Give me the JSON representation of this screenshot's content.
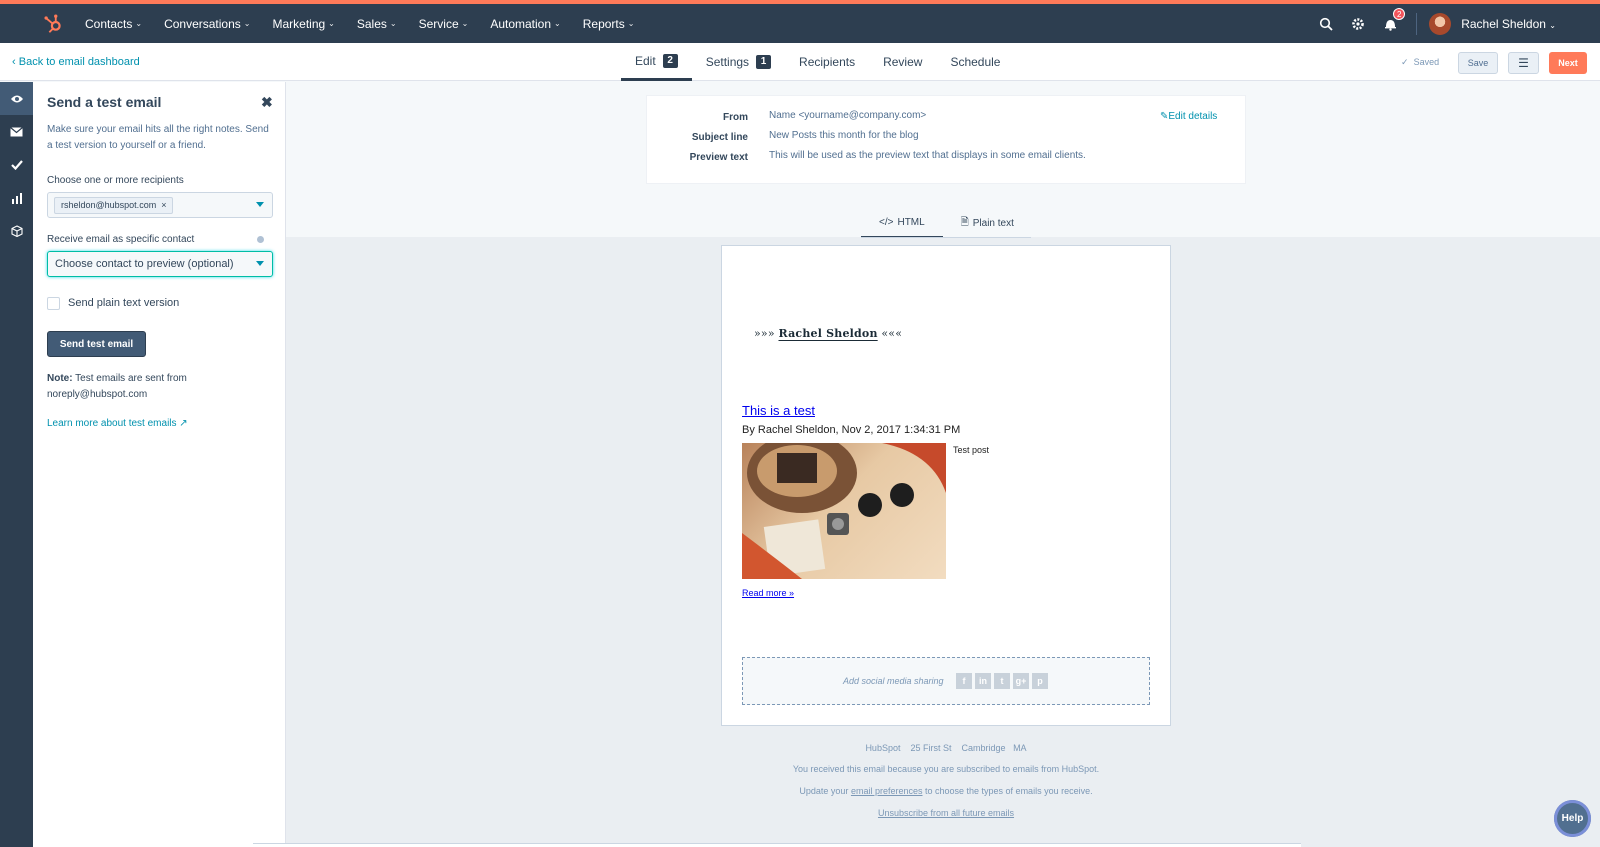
{
  "topnav": {
    "items": [
      "Contacts",
      "Conversations",
      "Marketing",
      "Sales",
      "Service",
      "Automation",
      "Reports"
    ],
    "notification_count": "2",
    "user_name": "Rachel Sheldon"
  },
  "subheader": {
    "back_link": "Back to email dashboard",
    "tabs": [
      {
        "label": "Edit",
        "badge": "2"
      },
      {
        "label": "Settings",
        "badge": "1"
      },
      {
        "label": "Recipients"
      },
      {
        "label": "Review"
      },
      {
        "label": "Schedule"
      }
    ],
    "saved_label": "Saved",
    "save_label": "Save",
    "next_label": "Next"
  },
  "rail": {
    "icons": [
      "eye-icon",
      "envelope-icon",
      "checkmark-icon",
      "analytics-icon",
      "box-icon"
    ]
  },
  "test_panel": {
    "title": "Send a test email",
    "description": "Make sure your email hits all the right notes. Send a test version to yourself or a friend.",
    "recipients_label": "Choose one or more recipients",
    "recipient_chip": "rsheldon@hubspot.com",
    "contact_label": "Receive email as specific contact",
    "contact_placeholder": "Choose contact to preview (optional)",
    "plain_text_label": "Send plain text version",
    "send_button": "Send test email",
    "note_label": "Note:",
    "note_text": "Test emails are sent from noreply@hubspot.com",
    "learn_more": "Learn more about test emails"
  },
  "details": {
    "from_label": "From",
    "from_value": "Name <yourname@company.com>",
    "subject_label": "Subject line",
    "subject_value": "New Posts this month for the blog",
    "preview_label": "Preview text",
    "preview_value": "This will be used as the preview text that displays in some email clients.",
    "edit_link": "Edit details"
  },
  "preview_tabs": {
    "html": "HTML",
    "plain": "Plain text"
  },
  "email": {
    "brand_text": "Rachel Sheldon",
    "post_title": "This is a test",
    "byline": "By Rachel Sheldon, Nov 2, 2017 1:34:31 PM",
    "post_body": "Test post",
    "read_more": "Read more »",
    "social_label": "Add social media sharing"
  },
  "footer": {
    "company": "HubSpot",
    "address": "25 First St",
    "city": "Cambridge",
    "state": "MA",
    "line1": "You received this email because you are subscribed to emails from HubSpot.",
    "line2_pre": "Update your",
    "line2_link": "email preferences",
    "line2_post": "to choose the types of emails you receive.",
    "unsubscribe": "Unsubscribe from all future emails"
  },
  "help": "Help",
  "colors": {
    "nav_bg": "#2d3e50",
    "accent": "#ff7a59",
    "link": "#0091ae",
    "annotation_arrow": "#e8262b"
  }
}
